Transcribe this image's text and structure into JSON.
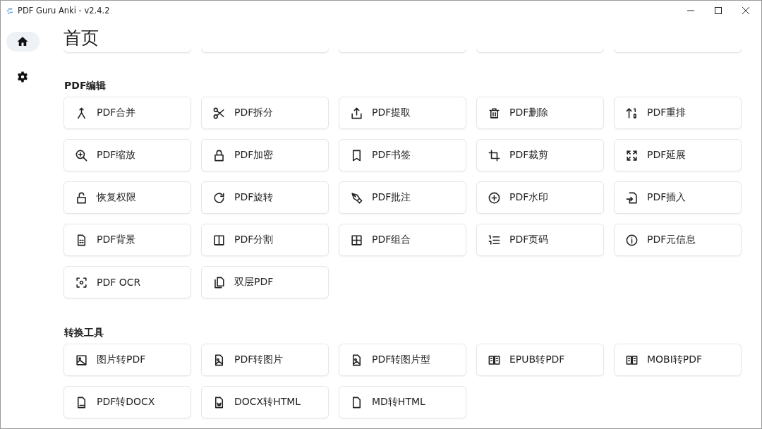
{
  "window": {
    "title": "PDF Guru Anki - v2.4.2"
  },
  "sidebar": {
    "items": [
      {
        "kind": "home",
        "selected": true
      },
      {
        "kind": "settings",
        "selected": false
      }
    ]
  },
  "page_title": "首页",
  "sections": [
    {
      "title": "PDF编辑",
      "tools": [
        {
          "label": "PDF合并"
        },
        {
          "label": "PDF拆分"
        },
        {
          "label": "PDF提取"
        },
        {
          "label": "PDF删除"
        },
        {
          "label": "PDF重排"
        },
        {
          "label": "PDF缩放"
        },
        {
          "label": "PDF加密"
        },
        {
          "label": "PDF书签"
        },
        {
          "label": "PDF裁剪"
        },
        {
          "label": "PDF延展"
        },
        {
          "label": "恢复权限"
        },
        {
          "label": "PDF旋转"
        },
        {
          "label": "PDF批注"
        },
        {
          "label": "PDF水印"
        },
        {
          "label": "PDF插入"
        },
        {
          "label": "PDF背景"
        },
        {
          "label": "PDF分割"
        },
        {
          "label": "PDF组合"
        },
        {
          "label": "PDF页码"
        },
        {
          "label": "PDF元信息"
        },
        {
          "label": "PDF OCR"
        },
        {
          "label": "双层PDF"
        }
      ]
    },
    {
      "title": "转换工具",
      "tools": [
        {
          "label": "图片转PDF"
        },
        {
          "label": "PDF转图片"
        },
        {
          "label": "PDF转图片型"
        },
        {
          "label": "EPUB转PDF"
        },
        {
          "label": "MOBI转PDF"
        },
        {
          "label": "PDF转DOCX"
        },
        {
          "label": "DOCX转HTML"
        },
        {
          "label": "MD转HTML"
        }
      ]
    }
  ]
}
